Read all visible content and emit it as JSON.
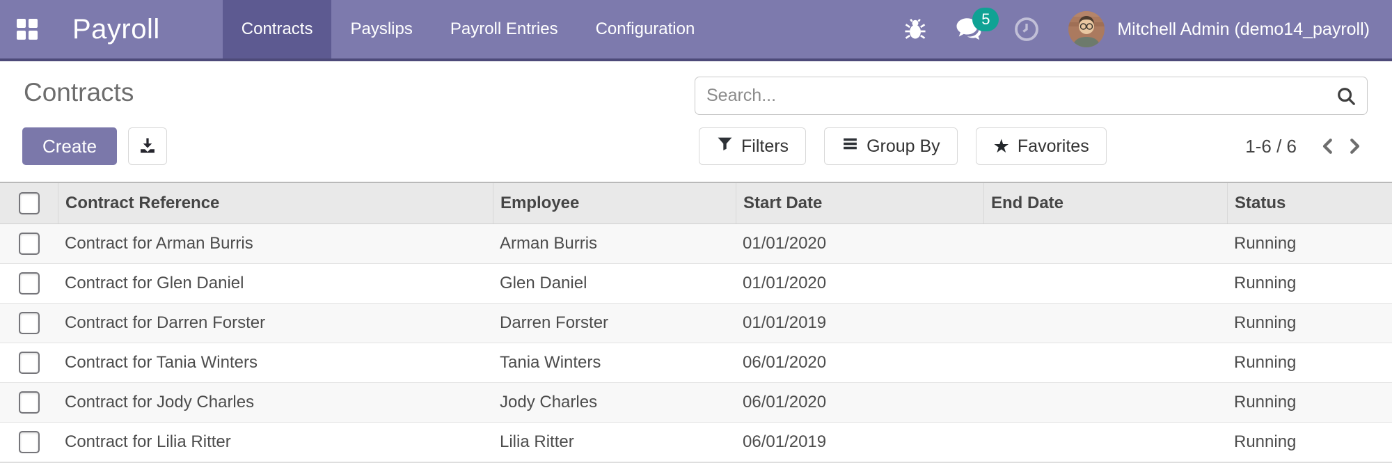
{
  "colors": {
    "navbar_bg": "#7d7aad",
    "navbar_active": "#5d5a91",
    "navbar_border": "#4d4a79",
    "accent": "#7b78aa",
    "badge": "#0fa294",
    "title_text": "#6d6d6d",
    "header_bg": "#e9e9e9",
    "header_text": "#454545",
    "body_text": "#4c4c4c",
    "row_alt": "#f8f8f8",
    "footer_bg": "#ededed"
  },
  "icons": {
    "apps_menu": "grid-2x2-squares",
    "debug": "bug",
    "messages": "chat-bubbles",
    "activities": "clock",
    "search": "magnifying-glass",
    "export": "download-tray",
    "filters": "funnel",
    "group_by": "horizontal-bars",
    "favorites": "star",
    "pager_prev": "chevron-left",
    "pager_next": "chevron-right",
    "row_select": "checkbox"
  },
  "navbar": {
    "app_name": "Payroll",
    "menu_items": [
      {
        "label": "Contracts",
        "active": true
      },
      {
        "label": "Payslips",
        "active": false
      },
      {
        "label": "Payroll Entries",
        "active": false
      },
      {
        "label": "Configuration",
        "active": false
      }
    ],
    "messages_badge": "5",
    "user_name": "Mitchell Admin (demo14_payroll)"
  },
  "control_panel": {
    "title": "Contracts",
    "create_label": "Create",
    "search_placeholder": "Search...",
    "filters_label": "Filters",
    "group_by_label": "Group By",
    "favorites_label": "Favorites",
    "pager": "1-6 / 6"
  },
  "table": {
    "columns": [
      "Contract Reference",
      "Employee",
      "Start Date",
      "End Date",
      "Status"
    ],
    "rows": [
      {
        "contract": "Contract for Arman Burris",
        "employee": "Arman Burris",
        "start": "01/01/2020",
        "end": "",
        "status": "Running"
      },
      {
        "contract": "Contract for Glen Daniel",
        "employee": "Glen Daniel",
        "start": "01/01/2020",
        "end": "",
        "status": "Running"
      },
      {
        "contract": "Contract for Darren Forster",
        "employee": "Darren Forster",
        "start": "01/01/2019",
        "end": "",
        "status": "Running"
      },
      {
        "contract": "Contract for Tania Winters",
        "employee": "Tania Winters",
        "start": "06/01/2020",
        "end": "",
        "status": "Running"
      },
      {
        "contract": "Contract for Jody Charles",
        "employee": "Jody Charles",
        "start": "06/01/2020",
        "end": "",
        "status": "Running"
      },
      {
        "contract": "Contract for Lilia Ritter",
        "employee": "Lilia Ritter",
        "start": "06/01/2019",
        "end": "",
        "status": "Running"
      }
    ]
  }
}
